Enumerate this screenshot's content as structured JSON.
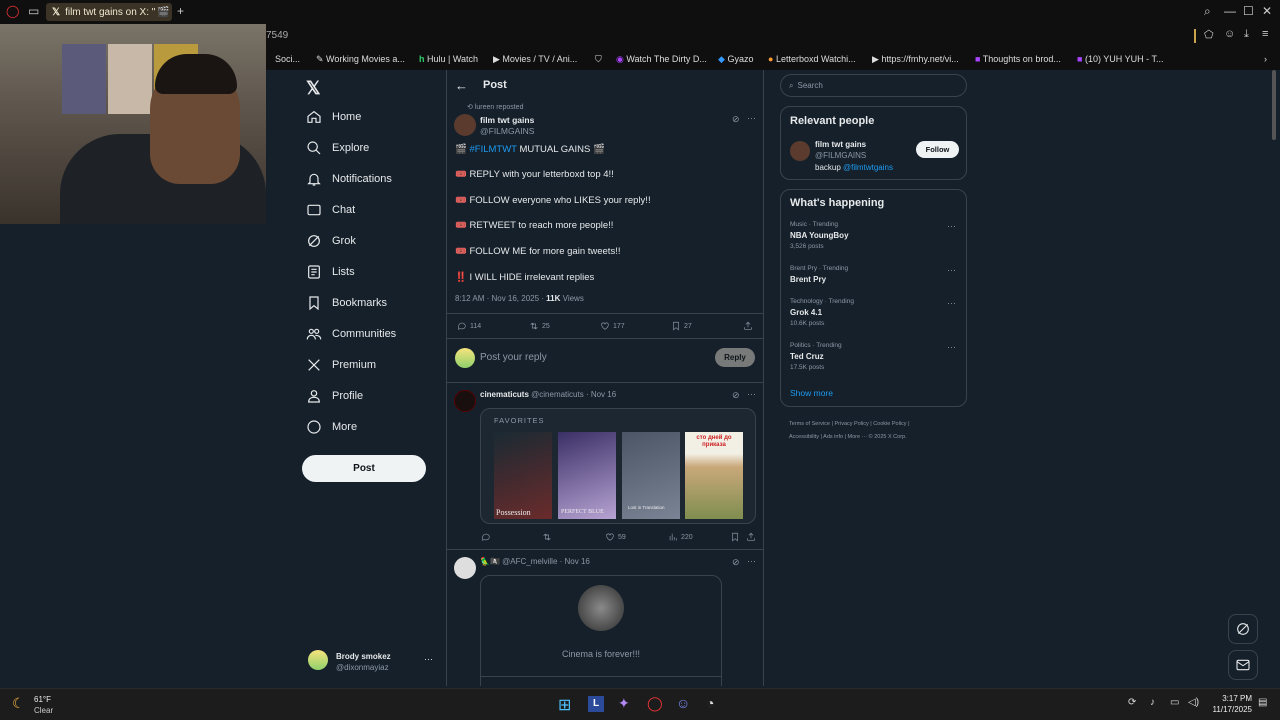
{
  "browser": {
    "tab_title": "film twt gains on X: \"",
    "tab_emoji": "🎬 #",
    "url_fragment": "7549",
    "bookmarks": [
      "Soci...",
      "Working Movies a...",
      "Hulu | Watch",
      "Movies / TV / Ani...",
      "Watch The Dirty D...",
      "Gyazo",
      "Letterboxd Watchi...",
      "https://fmhy.net/vi...",
      "Thoughts on brod...",
      "(10) YUH YUH - T..."
    ]
  },
  "nav": {
    "items": [
      "Home",
      "Explore",
      "Notifications",
      "Chat",
      "Grok",
      "Lists",
      "Bookmarks",
      "Communities",
      "Premium",
      "Profile",
      "More"
    ],
    "post_button": "Post",
    "user_name": "Brody smokez",
    "user_handle": "@dixonmayiaz",
    "user_more": "···"
  },
  "main": {
    "header_title": "Post",
    "repost_note": "lureen reposted",
    "author_name": "film twt gains",
    "author_handle": "@FILMGAINS",
    "lines": [
      {
        "emoji": "🎬",
        "text": " MUTUAL GAINS 🎬",
        "hashtag": "#FILMTWT"
      },
      {
        "emoji": "🎟️",
        "text": "REPLY with your letterboxd top 4!!"
      },
      {
        "emoji": "🎟️",
        "text": "FOLLOW everyone who LIKES your reply!!"
      },
      {
        "emoji": "🎟️",
        "text": "RETWEET to reach more people!!"
      },
      {
        "emoji": "🎟️",
        "text": "FOLLOW ME for more gain tweets!!"
      },
      {
        "emoji": "‼️",
        "text": "I WILL HIDE irrelevant replies"
      }
    ],
    "timestamp": "8:12 AM · Nov 16, 2025 · ",
    "views_count": "11K",
    "views_label": " Views",
    "counts": {
      "replies": "114",
      "reposts": "25",
      "likes": "177",
      "bookmarks": "27"
    },
    "reply_placeholder": "Post your reply",
    "reply_button": "Reply",
    "reply1": {
      "name": "cinematicuts",
      "handle_date": "@cinematicuts · Nov 16",
      "card_label": "FAVORITES",
      "posters": [
        "Possession",
        "PERFECT BLUE",
        "Lost in Translation",
        "сто дней до приказа"
      ],
      "likes": "59",
      "views": "220"
    },
    "reply2": {
      "name_emoji": "🦜🏴‍☠️",
      "handle_date": "@AFC_melville · Nov 16",
      "card_text": "Cinema is forever!!!"
    }
  },
  "sidebar": {
    "search_placeholder": "Search",
    "relevant_title": "Relevant people",
    "rp_name": "film twt gains",
    "rp_handle": "@FILMGAINS",
    "rp_follow": "Follow",
    "rp_bio_prefix": "backup ",
    "rp_bio_link": "@filmtwtgains",
    "happening_title": "What's happening",
    "trends": [
      {
        "category": "Music · Trending",
        "name": "NBA YoungBoy",
        "count": "3,526 posts"
      },
      {
        "category": "Brent Pry · Trending",
        "name": "Brent Pry",
        "count": ""
      },
      {
        "category": "Technology · Trending",
        "name": "Grok 4.1",
        "count": "10.6K posts"
      },
      {
        "category": "Politics · Trending",
        "name": "Ted Cruz",
        "count": "17.5K posts"
      }
    ],
    "show_more": "Show more",
    "footer_links": [
      "Terms of Service",
      "|",
      "Privacy Policy",
      "|",
      "Cookie Policy",
      "|",
      "Accessibility",
      "|",
      "Ads info",
      "|",
      "More ···",
      "© 2025 X Corp."
    ]
  },
  "taskbar": {
    "weather_temp": "61°F",
    "weather_desc": "Clear",
    "time": "3:17 PM",
    "date": "11/17/2025"
  }
}
